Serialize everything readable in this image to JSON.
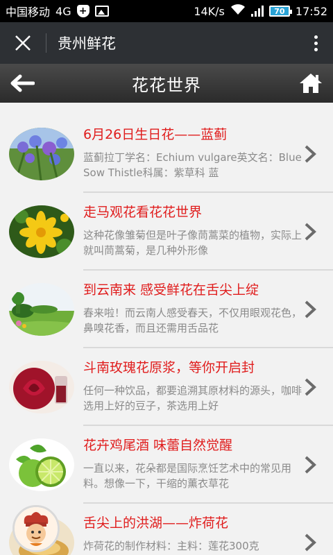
{
  "status": {
    "carrier": "中国移动",
    "network": "4G",
    "speed": "14K/s",
    "battery": "70",
    "time": "17:52"
  },
  "app": {
    "title": "贵州鲜花"
  },
  "header": {
    "title": "花花世界"
  },
  "items": [
    {
      "title": "6月26日生日花——蓝蓟",
      "desc": "蓝蓟拉丁学名：Echium vulgare英文名：Blue Sow Thistle科属：紫草科 蓝"
    },
    {
      "title": "走马观花看花花世界",
      "desc": "这种花像雏菊但是叶子像茼蒿菜的植物，实际上就叫茼蒿菊，是几种外形像"
    },
    {
      "title": "到云南来 感受鲜花在舌尖上绽",
      "desc": "春来啦！而云南人感受春天，不仅用眼观花色，鼻嗅花香，而且还需用舌品花"
    },
    {
      "title": "斗南玫瑰花原浆，等你开启封",
      "desc": "任何一种饮品，都要追溯其原材料的源头，咖啡选用上好的豆子，茶选用上好"
    },
    {
      "title": "花卉鸡尾酒 味蕾自然觉醒",
      "desc": "一直以来，花朵都是国际烹饪艺术中的常见用料。想像一下，干缩的薰衣草花"
    },
    {
      "title": "舌尖上的洪湖——炸荷花",
      "desc": "炸荷花的制作材料：主料：莲花300克"
    }
  ]
}
